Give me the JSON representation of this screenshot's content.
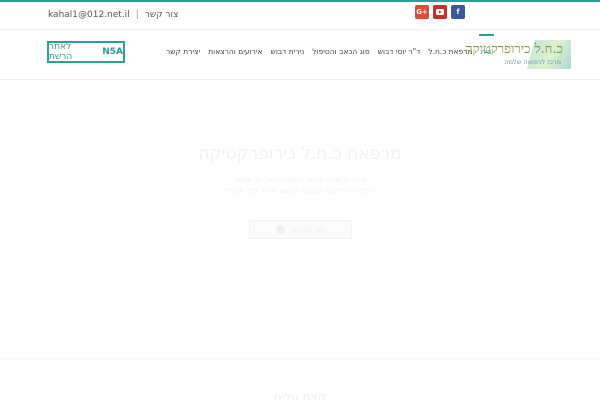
{
  "topbar": {
    "email": "kahal1@012.net.il",
    "contact_label": "צור קשר",
    "separator": "|",
    "social": [
      "G+",
      "YouTube",
      "f"
    ]
  },
  "header": {
    "cta": {
      "brand": "N5A",
      "label": "לאתר הרשת"
    },
    "nav_items": [
      "יצירת קשר",
      "אירועים והרצאות",
      "נירית דבוש",
      "סוג הכאב והטיפול",
      "ד\"ר יוסי דבוש",
      "מרפאת כ.ח.ל",
      "בית"
    ],
    "active_nav": "בית",
    "logo": {
      "main": "כ.ח.ל כירופרקטיקה",
      "sub": "מרכז לרפואה שלמה"
    }
  },
  "hero": {
    "title": "מרפאת כ.ח.ל כירופרקטיקה",
    "line1": "מרכז לרפואה שלמה לטיפול בכאבי גב וצוואר",
    "line2": "טיפול כירופרקטי מקצועי מותאם אישית לכל מטופל",
    "button_label": "צפו בסרטון"
  },
  "section": {
    "title": "קצת עלינו"
  },
  "colors": {
    "accent": "#2aa198",
    "googleplus": "#dd4b39",
    "youtube": "#c4302b",
    "facebook": "#3b5998"
  }
}
